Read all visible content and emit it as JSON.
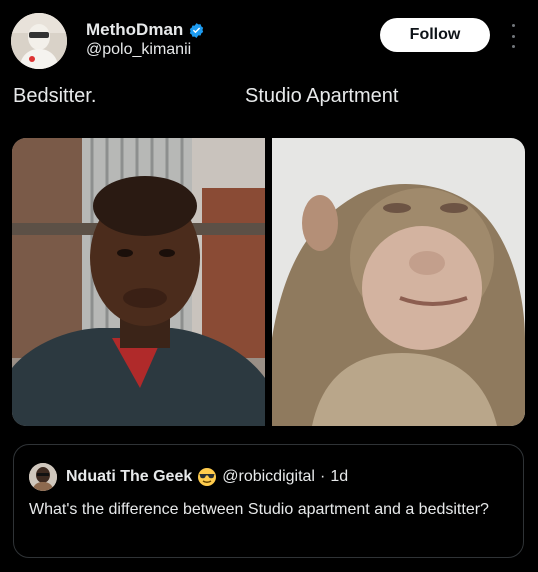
{
  "author": {
    "display_name": "MethoDman",
    "handle": "@polo_kimanii",
    "verified": true,
    "avatar_icon": "profile-avatar"
  },
  "follow_label": "Follow",
  "more_icon": "more-options-icon",
  "post": {
    "text_left": "Bedsitter.",
    "text_right": "Studio Apartment",
    "media": [
      {
        "name": "photo-man-selfie"
      },
      {
        "name": "photo-monkey"
      }
    ]
  },
  "quote": {
    "display_name": "Nduati The Geek",
    "emoji": "😎",
    "handle": "@robicdigital",
    "separator": "·",
    "time": "1d",
    "text": "What's the difference between Studio apartment and a bedsitter?"
  },
  "colors": {
    "background": "#000000",
    "text": "#e7e9ea",
    "verified": "#1d9bf0",
    "border": "#2f3336"
  }
}
